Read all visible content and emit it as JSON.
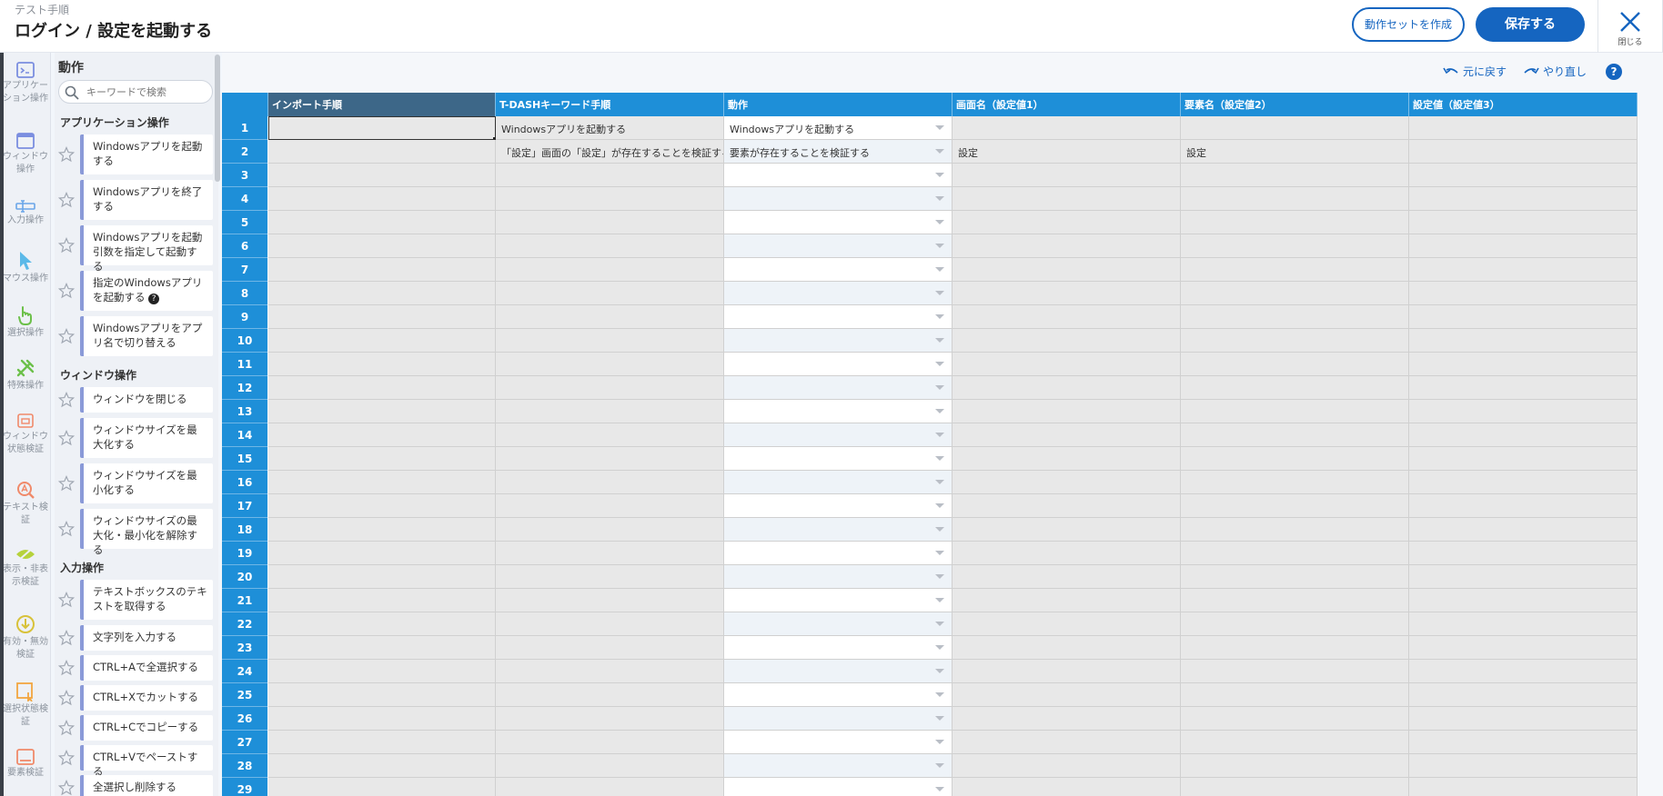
{
  "header": {
    "subtitle": "テスト手順",
    "title": "ログイン / 設定を起動する",
    "create_set_label": "動作セットを作成",
    "save_label": "保存する",
    "close_label": "閉じる"
  },
  "rail": [
    {
      "label": "アプリケーション操作",
      "icon": "terminal-window-icon",
      "color": "#7b8ee0"
    },
    {
      "label": "ウィンドウ操作",
      "icon": "window-icon",
      "color": "#7b8ee0"
    },
    {
      "label": "入力操作",
      "icon": "text-cursor-icon",
      "color": "#6aa6e8"
    },
    {
      "label": "マウス操作",
      "icon": "mouse-pointer-icon",
      "color": "#5bb9e8"
    },
    {
      "label": "選択操作",
      "icon": "hand-pointer-icon",
      "color": "#6cc04a"
    },
    {
      "label": "特殊操作",
      "icon": "tools-icon",
      "color": "#6cc04a"
    },
    {
      "label": "ウィンドウ状態検証",
      "icon": "window-check-icon",
      "color": "#f08a6a"
    },
    {
      "label": "テキスト検証",
      "icon": "text-search-icon",
      "color": "#f08a6a"
    },
    {
      "label": "表示・非表示検証",
      "icon": "eye-off-icon",
      "color": "#b6d23c"
    },
    {
      "label": "有効・無効検証",
      "icon": "arrow-circle-icon",
      "color": "#d8c23a"
    },
    {
      "label": "選択状態検証",
      "icon": "select-check-icon",
      "color": "#f2a640"
    },
    {
      "label": "要素検証",
      "icon": "element-icon",
      "color": "#f08a6a"
    }
  ],
  "panel": {
    "title": "動作",
    "search_placeholder": "キーワードで検索",
    "categories": [
      {
        "name": "アプリケーション操作",
        "items": [
          {
            "label": "Windowsアプリを起動する"
          },
          {
            "label": "Windowsアプリを終了する"
          },
          {
            "label": "Windowsアプリを起動引数を指定して起動する"
          },
          {
            "label": "指定のWindowsアプリを起動する",
            "help": "?"
          },
          {
            "label": "Windowsアプリをアプリ名で切り替える"
          }
        ]
      },
      {
        "name": "ウィンドウ操作",
        "items": [
          {
            "label": "ウィンドウを閉じる"
          },
          {
            "label": "ウィンドウサイズを最大化する"
          },
          {
            "label": "ウィンドウサイズを最小化する"
          },
          {
            "label": "ウィンドウサイズの最大化・最小化を解除する"
          }
        ]
      },
      {
        "name": "入力操作",
        "items": [
          {
            "label": "テキストボックスのテキストを取得する"
          },
          {
            "label": "文字列を入力する"
          },
          {
            "label": "CTRL+Aで全選択する"
          },
          {
            "label": "CTRL+Xでカットする"
          },
          {
            "label": "CTRL+Cでコピーする"
          },
          {
            "label": "CTRL+Vでペーストする"
          },
          {
            "label": "全選択し削除する"
          }
        ]
      }
    ]
  },
  "toolbar": {
    "undo_label": "元に戻す",
    "redo_label": "やり直し",
    "help_label": "?"
  },
  "grid": {
    "columns": [
      "インポート手順",
      "T-DASHキーワード手順",
      "動作",
      "画面名（設定値1）",
      "要素名（設定値2）",
      "設定値（設定値3）"
    ],
    "rows": [
      [
        "",
        "Windowsアプリを起動する",
        "Windowsアプリを起動する",
        "",
        "",
        ""
      ],
      [
        "",
        "「設定」画面の「設定」が存在することを検証する",
        "要素が存在することを検証する",
        "設定",
        "設定",
        ""
      ],
      [
        "",
        "",
        "",
        "",
        "",
        ""
      ],
      [
        "",
        "",
        "",
        "",
        "",
        ""
      ],
      [
        "",
        "",
        "",
        "",
        "",
        ""
      ],
      [
        "",
        "",
        "",
        "",
        "",
        ""
      ],
      [
        "",
        "",
        "",
        "",
        "",
        ""
      ],
      [
        "",
        "",
        "",
        "",
        "",
        ""
      ],
      [
        "",
        "",
        "",
        "",
        "",
        ""
      ],
      [
        "",
        "",
        "",
        "",
        "",
        ""
      ],
      [
        "",
        "",
        "",
        "",
        "",
        ""
      ],
      [
        "",
        "",
        "",
        "",
        "",
        ""
      ],
      [
        "",
        "",
        "",
        "",
        "",
        ""
      ],
      [
        "",
        "",
        "",
        "",
        "",
        ""
      ],
      [
        "",
        "",
        "",
        "",
        "",
        ""
      ],
      [
        "",
        "",
        "",
        "",
        "",
        ""
      ],
      [
        "",
        "",
        "",
        "",
        "",
        ""
      ],
      [
        "",
        "",
        "",
        "",
        "",
        ""
      ],
      [
        "",
        "",
        "",
        "",
        "",
        ""
      ],
      [
        "",
        "",
        "",
        "",
        "",
        ""
      ],
      [
        "",
        "",
        "",
        "",
        "",
        ""
      ],
      [
        "",
        "",
        "",
        "",
        "",
        ""
      ],
      [
        "",
        "",
        "",
        "",
        "",
        ""
      ],
      [
        "",
        "",
        "",
        "",
        "",
        ""
      ],
      [
        "",
        "",
        "",
        "",
        "",
        ""
      ],
      [
        "",
        "",
        "",
        "",
        "",
        ""
      ],
      [
        "",
        "",
        "",
        "",
        "",
        ""
      ],
      [
        "",
        "",
        "",
        "",
        "",
        ""
      ],
      [
        "",
        "",
        "",
        "",
        "",
        ""
      ]
    ]
  }
}
